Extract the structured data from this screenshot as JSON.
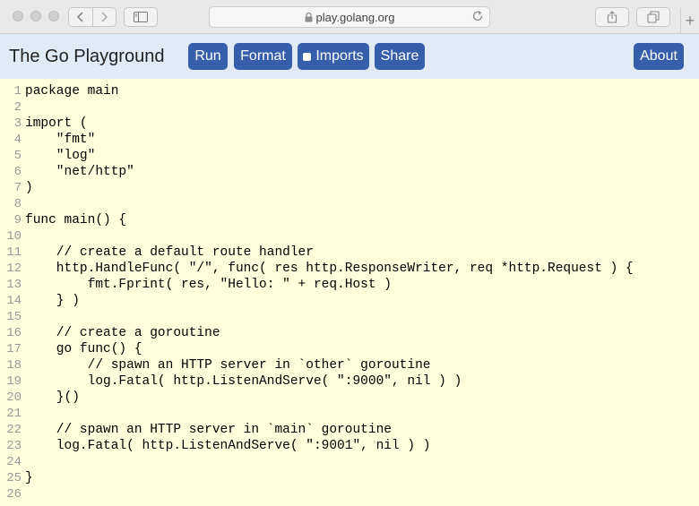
{
  "browser": {
    "url": "play.golang.org",
    "new_tab_label": "+"
  },
  "app": {
    "title": "The Go Playground",
    "buttons": {
      "run": "Run",
      "format": "Format",
      "imports": "Imports",
      "share": "Share",
      "about": "About"
    },
    "imports_checked": false
  },
  "editor": {
    "line_numbers": [
      "1",
      "2",
      "3",
      "4",
      "5",
      "6",
      "7",
      "8",
      "9",
      "10",
      "11",
      "12",
      "13",
      "14",
      "15",
      "16",
      "17",
      "18",
      "19",
      "20",
      "21",
      "22",
      "23",
      "24",
      "25",
      "26"
    ],
    "lines": [
      "package main",
      "",
      "import (",
      "    \"fmt\"",
      "    \"log\"",
      "    \"net/http\"",
      ")",
      "",
      "func main() {",
      "",
      "    // create a default route handler",
      "    http.HandleFunc( \"/\", func( res http.ResponseWriter, req *http.Request ) {",
      "        fmt.Fprint( res, \"Hello: \" + req.Host )",
      "    } )",
      "",
      "    // create a goroutine",
      "    go func() {",
      "        // spawn an HTTP server in `other` goroutine",
      "        log.Fatal( http.ListenAndServe( \":9000\", nil ) )",
      "    }()",
      "",
      "    // spawn an HTTP server in `main` goroutine",
      "    log.Fatal( http.ListenAndServe( \":9001\", nil ) )",
      "",
      "}",
      ""
    ]
  }
}
